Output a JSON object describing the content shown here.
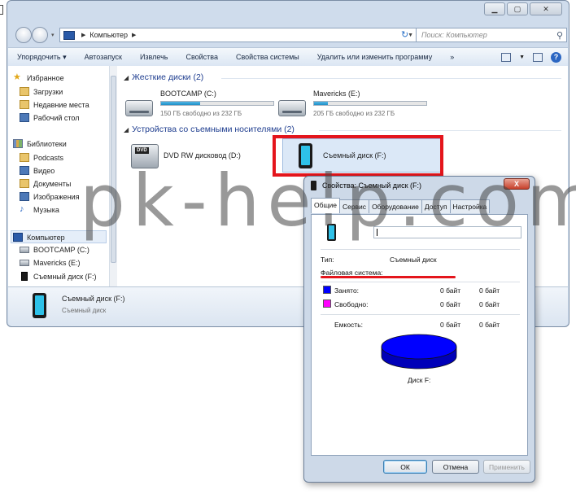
{
  "address": {
    "crumb": "Компьютер",
    "search_placeholder": "Поиск: Компьютер"
  },
  "toolbar": {
    "organize": "Упорядочить",
    "autoplay": "Автозапуск",
    "eject": "Извлечь",
    "properties": "Свойства",
    "system_properties": "Свойства системы",
    "uninstall": "Удалить или изменить программу",
    "more": "»",
    "help": "?"
  },
  "nav": {
    "favorites": "Избранное",
    "downloads": "Загрузки",
    "recent": "Недавние места",
    "desktop": "Рабочий стол",
    "libraries": "Библиотеки",
    "podcasts": "Podcasts",
    "video": "Видео",
    "documents": "Документы",
    "images": "Изображения",
    "music": "Музыка",
    "computer": "Компьютер",
    "drive_c": "BOOTCAMP (C:)",
    "drive_e": "Mavericks (E:)",
    "drive_f": "Съемный диск (F:)"
  },
  "content": {
    "hdd_group": "Жесткие диски (2)",
    "removable_group": "Устройства со съемными носителями (2)",
    "drives": [
      {
        "name": "BOOTCAMP (C:)",
        "free": "150 ГБ свободно из 232 ГБ",
        "used_fraction": 0.35
      },
      {
        "name": "Mavericks (E:)",
        "free": "205 ГБ свободно из 232 ГБ",
        "used_fraction": 0.12
      }
    ],
    "dvd": {
      "name": "DVD RW дисковод (D:)",
      "badge": "DVD"
    },
    "usb": {
      "name": "Съемный диск (F:)"
    }
  },
  "details": {
    "name": "Съемный диск (F:)",
    "type": "Съемный диск"
  },
  "dialog": {
    "title": "Свойства: Съемный диск (F:)",
    "close": "X",
    "tabs": [
      "Общие",
      "Сервис",
      "Оборудование",
      "Доступ",
      "Настройка"
    ],
    "type_label": "Тип:",
    "type_value": "Съемный диск",
    "fs_label": "Файловая система:",
    "used_label": "Занято:",
    "used_bytes": "0 байт",
    "used_size": "0 байт",
    "free_label": "Свободно:",
    "free_bytes": "0 байт",
    "free_size": "0 байт",
    "capacity_label": "Емкость:",
    "capacity_bytes": "0 байт",
    "capacity_size": "0 байт",
    "disk_label": "Диск F:",
    "ok": "ОК",
    "cancel": "Отмена",
    "apply": "Применить",
    "colors": {
      "used": "#0000ff",
      "free": "#ff00ff",
      "highlight": "#e4151c"
    }
  },
  "watermark": "pk-help.com"
}
